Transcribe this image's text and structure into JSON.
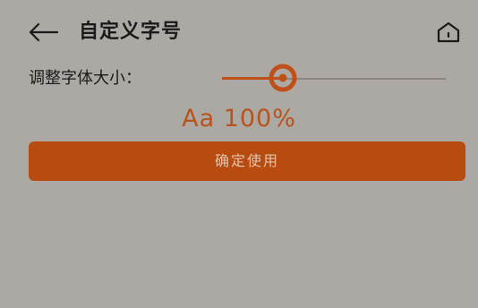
{
  "header": {
    "title": "自定义字号",
    "back_icon": "arrow-left-icon",
    "home_icon": "home-icon"
  },
  "font_size": {
    "label": "调整字体大小：",
    "slider_value": 0.27,
    "preview": "Aa 100%"
  },
  "actions": {
    "confirm_label": "确定使用"
  },
  "colors": {
    "background": "#aca8a4",
    "accent": "#b84c10",
    "preview_text": "#b7531d"
  }
}
